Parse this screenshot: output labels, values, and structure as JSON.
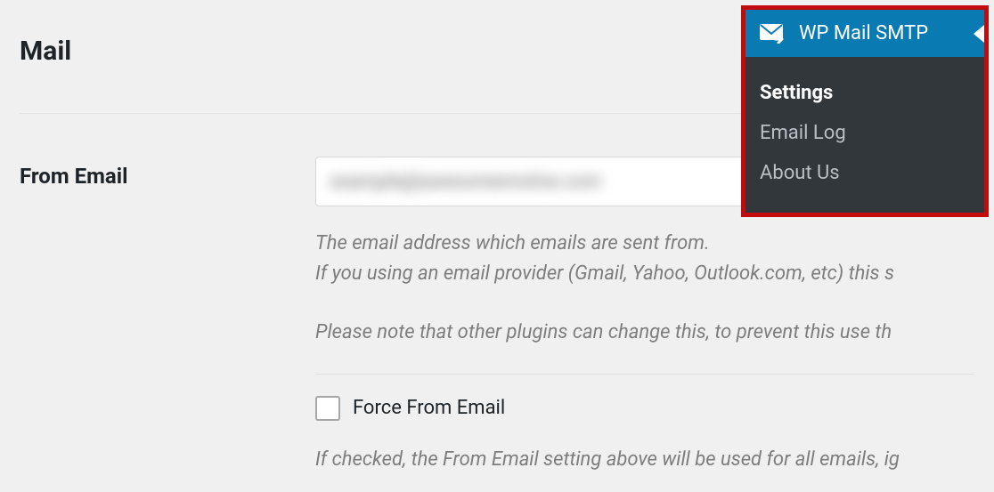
{
  "section": {
    "title": "Mail"
  },
  "from_email": {
    "label": "From Email",
    "value": "example@awesomemotive.com",
    "help1": "The email address which emails are sent from.",
    "help2": "If you using an email provider (Gmail, Yahoo, Outlook.com, etc) this s",
    "help3": "Please note that other plugins can change this, to prevent this use th"
  },
  "force_from": {
    "label": "Force From Email",
    "help": "If checked, the From Email setting above will be used for all emails, ig"
  },
  "flyout": {
    "title": "WP Mail SMTP",
    "items": [
      {
        "label": "Settings",
        "active": true
      },
      {
        "label": "Email Log",
        "active": false
      },
      {
        "label": "About Us",
        "active": false
      }
    ]
  }
}
